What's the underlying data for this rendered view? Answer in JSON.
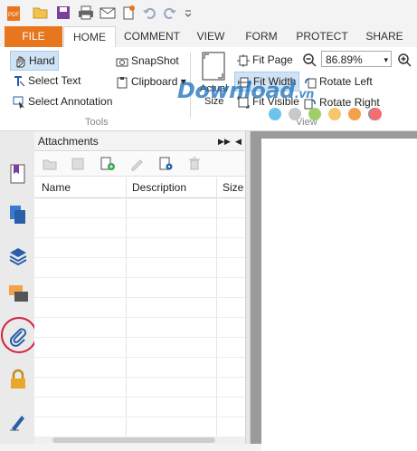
{
  "quick_access": {
    "icons": [
      "pdf-app-icon",
      "open-folder-icon",
      "save-icon",
      "print-icon",
      "email-icon",
      "new-icon",
      "undo-icon",
      "redo-icon",
      "customize-dropdown-icon"
    ]
  },
  "tabs": [
    "FILE",
    "HOME",
    "COMMENT",
    "VIEW",
    "FORM",
    "PROTECT",
    "SHARE"
  ],
  "active_tab": "HOME",
  "ribbon": {
    "hand": "Hand",
    "select_text": "Select Text",
    "select_annotation": "Select Annotation",
    "tools_group": "Tools",
    "snapshot": "SnapShot",
    "clipboard": "Clipboard",
    "actual_size_1": "Actual",
    "actual_size_2": "Size",
    "fit_page": "Fit Page",
    "fit_width": "Fit Width",
    "fit_visible": "Fit Visible",
    "zoom_value": "86.89%",
    "rotate_left": "Rotate Left",
    "rotate_right": "Rotate Right",
    "view_group": "View"
  },
  "watermark": {
    "text": "Download",
    "suffix": ".vn"
  },
  "dots_colors": [
    "#6cc4ee",
    "#c8c8c8",
    "#9ecf6b",
    "#f6c66a",
    "#f2a14a",
    "#5aa0d6",
    "#f26f6f"
  ],
  "panel": {
    "title": "Attachments",
    "columns": [
      "Name",
      "Description",
      "Size"
    ]
  },
  "sidebar_icons": [
    "bookmark-icon",
    "pages-icon",
    "layers-icon",
    "comments-icon",
    "attachment-icon",
    "security-icon",
    "signature-icon"
  ]
}
